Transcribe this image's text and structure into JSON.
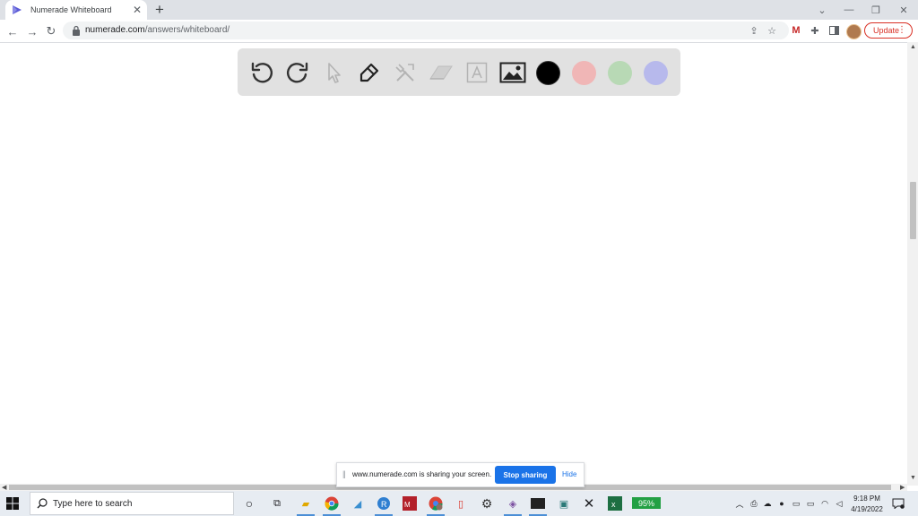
{
  "browser": {
    "tab_title": "Numerade Whiteboard",
    "new_tab_symbol": "+",
    "url_host": "numerade.com",
    "url_path": "/answers/whiteboard/",
    "update_label": "Update",
    "window_controls": [
      "minimize-icon",
      "restore-icon",
      "close-icon"
    ]
  },
  "whiteboard": {
    "tools": [
      "undo-icon",
      "redo-icon",
      "select-pointer-icon",
      "pen-icon",
      "tools-icon",
      "eraser-icon",
      "text-icon",
      "image-icon"
    ],
    "colors": [
      "#000000",
      "#f0b6b6",
      "#b8d9b5",
      "#b7b9ec"
    ],
    "selected_color": "#000000"
  },
  "share_banner": {
    "message": "www.numerade.com is sharing your screen.",
    "stop_label": "Stop sharing",
    "hide_label": "Hide"
  },
  "taskbar": {
    "search_placeholder": "Type here to search",
    "battery_percent": "95%",
    "time": "9:18 PM",
    "date": "4/19/2022"
  }
}
